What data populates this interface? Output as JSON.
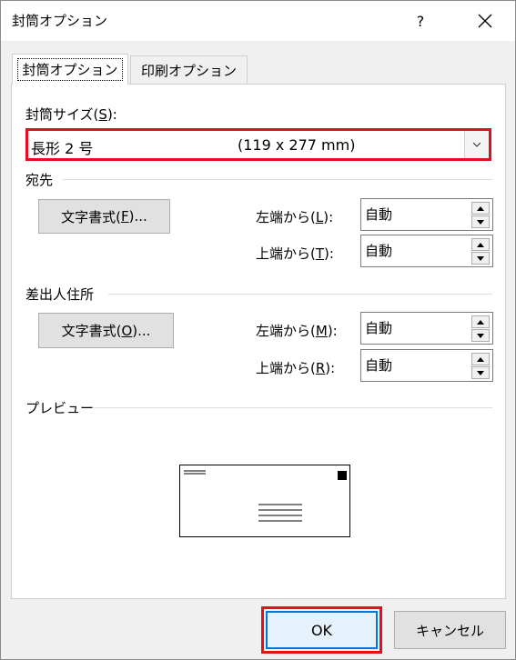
{
  "window": {
    "title": "封筒オプション",
    "help_label": "?"
  },
  "tabs": [
    {
      "label": "封筒オプション",
      "active": true
    },
    {
      "label": "印刷オプション",
      "active": false
    }
  ],
  "envelope_size": {
    "label_prefix": "封筒サイズ(",
    "label_key": "S",
    "label_suffix": "):",
    "selected_name": "長形 2 号",
    "selected_dims": "(119 x 277 mm)"
  },
  "delivery": {
    "heading": "宛先",
    "font_button": {
      "prefix": "文字書式(",
      "key": "F",
      "suffix": ")..."
    },
    "from_left": {
      "prefix": "左端から(",
      "key": "L",
      "suffix": "):",
      "value": "自動"
    },
    "from_top": {
      "prefix": "上端から(",
      "key": "T",
      "suffix": "):",
      "value": "自動"
    }
  },
  "return_address": {
    "heading": "差出人住所",
    "font_button": {
      "prefix": "文字書式(",
      "key": "O",
      "suffix": ")..."
    },
    "from_left": {
      "prefix": "左端から(",
      "key": "M",
      "suffix": "):",
      "value": "自動"
    },
    "from_top": {
      "prefix": "上端から(",
      "key": "R",
      "suffix": "):",
      "value": "自動"
    }
  },
  "preview": {
    "heading": "プレビュー"
  },
  "footer": {
    "ok_label": "OK",
    "cancel_label": "キャンセル"
  },
  "colors": {
    "highlight": "#e0101e",
    "default_button_border": "#0078d7"
  }
}
